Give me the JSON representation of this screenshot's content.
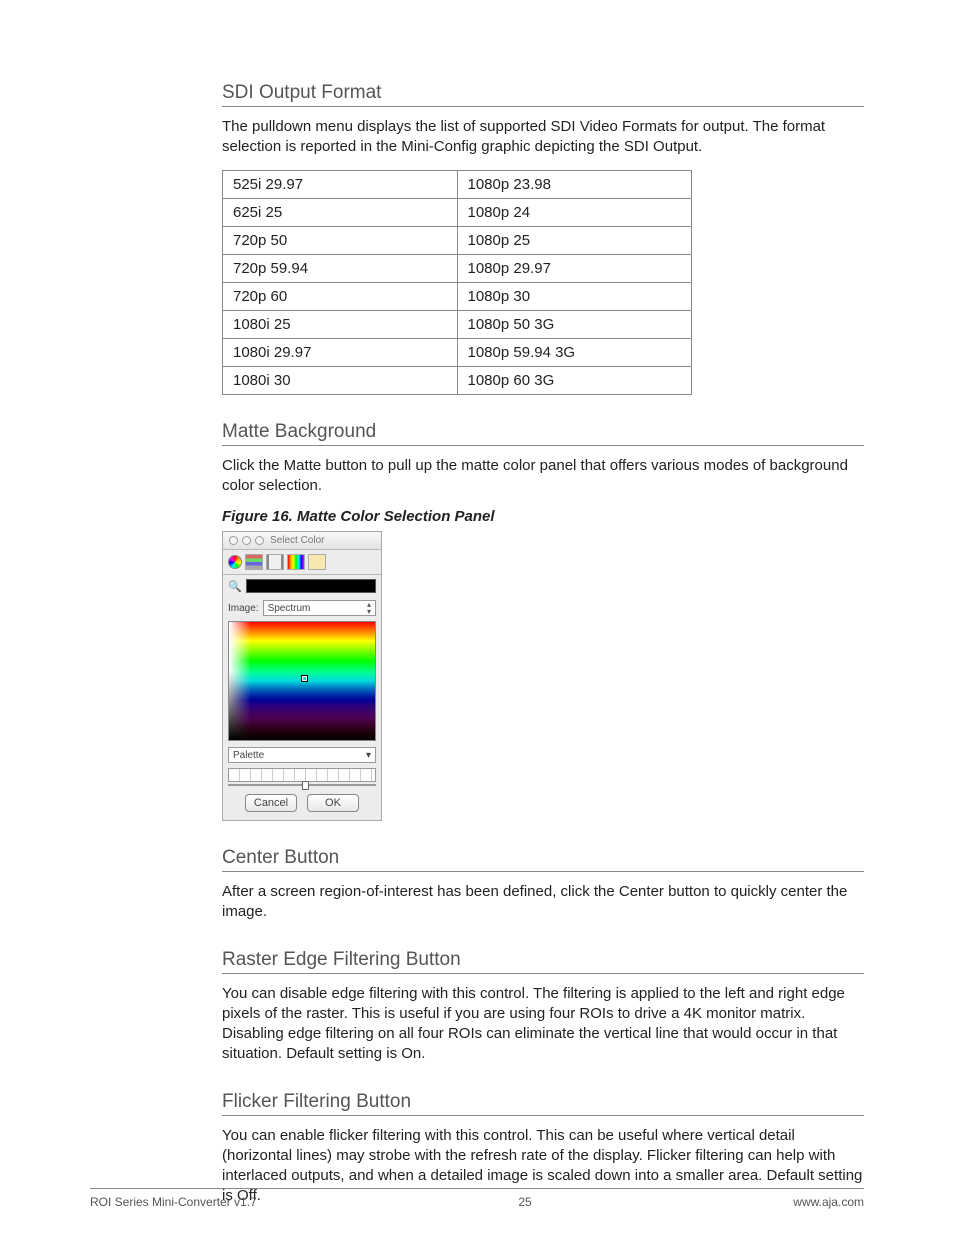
{
  "sections": {
    "sdi": {
      "heading": "SDI Output Format",
      "body": "The pulldown menu displays the list of supported SDI Video Formats for output. The format selection is reported in the Mini-Config graphic depicting the SDI Output.",
      "table": [
        [
          "525i 29.97",
          "1080p 23.98"
        ],
        [
          "625i 25",
          "1080p 24"
        ],
        [
          "720p 50",
          "1080p 25"
        ],
        [
          "720p 59.94",
          "1080p 29.97"
        ],
        [
          "720p 60",
          "1080p 30"
        ],
        [
          "1080i 25",
          "1080p 50 3G"
        ],
        [
          "1080i 29.97",
          "1080p 59.94 3G"
        ],
        [
          "1080i 30",
          "1080p 60 3G"
        ]
      ]
    },
    "matte": {
      "heading": "Matte Background",
      "body": "Click the Matte button to pull up the matte color panel that offers various modes of background color selection.",
      "figure_caption": "Figure 16.  Matte Color Selection Panel"
    },
    "center": {
      "heading": "Center Button",
      "body": "After a screen region-of-interest has been defined, click the Center button to quickly center the image."
    },
    "raster": {
      "heading": "Raster Edge Filtering Button",
      "body": "You can disable edge filtering with this control. The filtering is applied to the left and right edge pixels of the raster. This is useful if you are using four ROIs to drive a 4K monitor matrix. Disabling edge filtering on all four ROIs can eliminate the vertical line that would occur in that situation. Default setting is On."
    },
    "flicker": {
      "heading": "Flicker Filtering Button",
      "body": "You can enable flicker filtering with this control. This can be useful where vertical detail (horizontal lines) may strobe with the refresh rate of the display. Flicker filtering can help with interlaced outputs, and when a detailed image is scaled down into a smaller area. Default setting is Off."
    }
  },
  "picker": {
    "title": "Select Color",
    "image_label": "Image:",
    "image_value": "Spectrum",
    "palette_label": "Palette",
    "cancel": "Cancel",
    "ok": "OK"
  },
  "footer": {
    "left": "ROI Series Mini-Converter v1.7",
    "center": "25",
    "right": "www.aja.com"
  }
}
